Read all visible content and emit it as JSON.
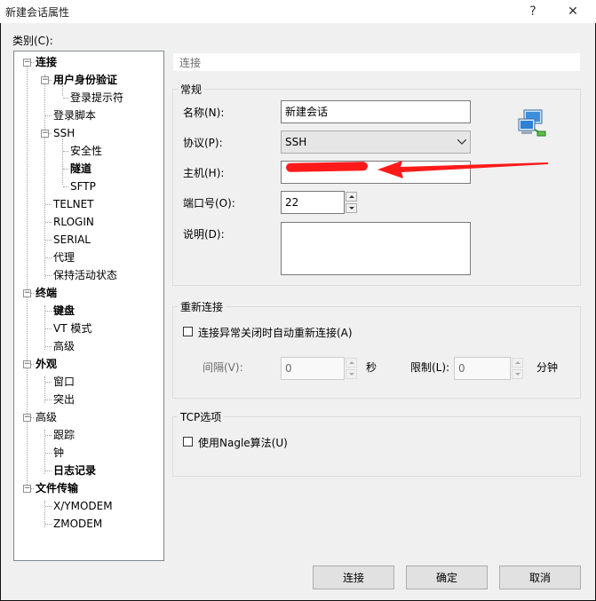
{
  "window": {
    "title": "新建会话属性",
    "help_glyph": "?",
    "close_glyph": "✕"
  },
  "category_label": "类别(C):",
  "tree": [
    {
      "label": "连接",
      "bold": true,
      "level": 0,
      "toggle": "−"
    },
    {
      "label": "用户身份验证",
      "bold": true,
      "level": 1,
      "toggle": "−"
    },
    {
      "label": "登录提示符",
      "bold": false,
      "level": 2
    },
    {
      "label": "登录脚本",
      "bold": false,
      "level": 1
    },
    {
      "label": "SSH",
      "bold": false,
      "level": 1,
      "toggle": "−"
    },
    {
      "label": "安全性",
      "bold": false,
      "level": 2
    },
    {
      "label": "隧道",
      "bold": true,
      "level": 2
    },
    {
      "label": "SFTP",
      "bold": false,
      "level": 2
    },
    {
      "label": "TELNET",
      "bold": false,
      "level": 1
    },
    {
      "label": "RLOGIN",
      "bold": false,
      "level": 1
    },
    {
      "label": "SERIAL",
      "bold": false,
      "level": 1
    },
    {
      "label": "代理",
      "bold": false,
      "level": 1
    },
    {
      "label": "保持活动状态",
      "bold": false,
      "level": 1
    },
    {
      "label": "终端",
      "bold": true,
      "level": 0,
      "toggle": "−"
    },
    {
      "label": "键盘",
      "bold": true,
      "level": 1
    },
    {
      "label": "VT 模式",
      "bold": false,
      "level": 1
    },
    {
      "label": "高级",
      "bold": false,
      "level": 1
    },
    {
      "label": "外观",
      "bold": true,
      "level": 0,
      "toggle": "−"
    },
    {
      "label": "窗口",
      "bold": false,
      "level": 1
    },
    {
      "label": "突出",
      "bold": false,
      "level": 1
    },
    {
      "label": "高级",
      "bold": false,
      "level": 0,
      "toggle": "−"
    },
    {
      "label": "跟踪",
      "bold": false,
      "level": 1
    },
    {
      "label": "钟",
      "bold": false,
      "level": 1
    },
    {
      "label": "日志记录",
      "bold": true,
      "level": 1
    },
    {
      "label": "文件传输",
      "bold": true,
      "level": 0,
      "toggle": "−"
    },
    {
      "label": "X/YMODEM",
      "bold": false,
      "level": 1
    },
    {
      "label": "ZMODEM",
      "bold": false,
      "level": 1
    }
  ],
  "panel": {
    "header": "连接",
    "general": {
      "title": "常规",
      "name_label": "名称(N):",
      "name_value": "新建会话",
      "protocol_label": "协议(P):",
      "protocol_value": "SSH",
      "host_label": "主机(H):",
      "port_label": "端口号(O):",
      "port_value": "22",
      "desc_label": "说明(D):",
      "desc_value": ""
    },
    "reconnect": {
      "title": "重新连接",
      "checkbox_label": "连接异常关闭时自动重新连接(A)",
      "checked": false,
      "interval_label": "间隔(V):",
      "interval_value": "0",
      "interval_unit": "秒",
      "limit_label": "限制(L):",
      "limit_value": "0",
      "limit_unit": "分钟"
    },
    "tcp": {
      "title": "TCP选项",
      "checkbox_label": "使用Nagle算法(U)",
      "checked": false
    }
  },
  "buttons": {
    "connect": "连接",
    "ok": "确定",
    "cancel": "取消"
  },
  "colors": {
    "annotation_red": "#ff1a1a"
  },
  "icons": {
    "session": "network-computer-icon",
    "annotation": "red-arrow-icon"
  }
}
